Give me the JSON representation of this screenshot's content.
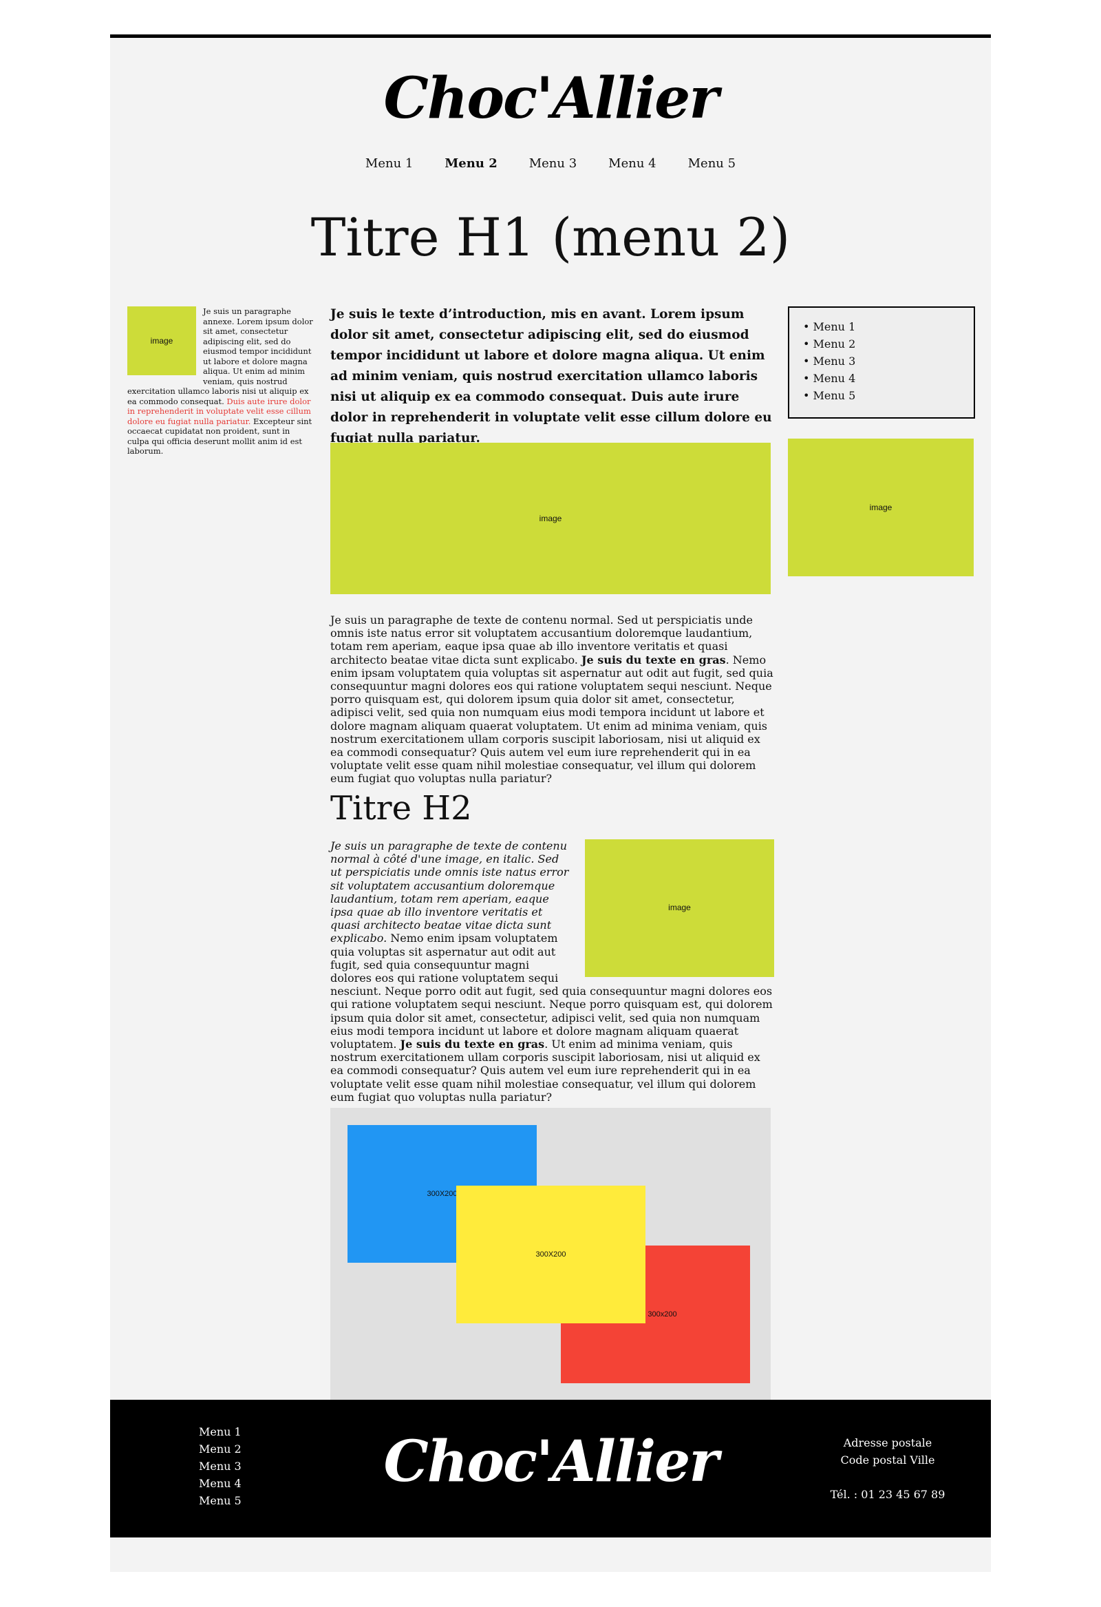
{
  "brand": {
    "logo_text": "Choc'Allier"
  },
  "nav": {
    "items": [
      "Menu 1",
      "Menu 2",
      "Menu 3",
      "Menu 4",
      "Menu 5"
    ],
    "active": "Menu 2"
  },
  "page_title": "Titre H1 (menu 2)",
  "left_column": {
    "image_label": "image",
    "text_before_red": "Je suis un paragraphe annexe. Lorem ipsum dolor sit amet, consectetur adipiscing elit, sed do eiusmod tempor incididunt ut labore et dolore magna aliqua. Ut enim ad minim veniam, quis nostrud exercitation ullamco laboris nisi ut aliquip ex ea commodo consequat. ",
    "red_text": "Duis aute irure dolor in reprehenderit in voluptate velit esse cillum dolore eu fugiat nulla pariatur.",
    "text_after_red": " Excepteur sint occaecat cupidatat non proident, sunt in culpa qui officia deserunt mollit anim id est laborum."
  },
  "intro": "Je suis le texte d’introduction, mis en avant. Lorem ipsum dolor sit amet, consectetur adipiscing elit, sed do eiusmod tempor incididunt ut labore et dolore magna aliqua. Ut enim ad minim veniam, quis nostrud exercitation ullamco laboris nisi ut aliquip ex ea commodo consequat. Duis aute irure dolor in reprehenderit in voluptate velit esse cillum dolore eu fugiat nulla pariatur.",
  "main_image_label": "image",
  "paragraph1": {
    "before_bold": "Je suis un paragraphe de texte de contenu normal. Sed ut perspiciatis unde omnis iste natus error sit voluptatem accusantium doloremque laudantium, totam rem aperiam, eaque ipsa quae ab illo inventore veritatis et quasi architecto beatae vitae dicta sunt explicabo. ",
    "bold": "Je suis du texte en gras",
    "after_bold": ". Nemo enim ipsam voluptatem quia voluptas sit aspernatur aut odit aut fugit, sed quia consequuntur magni dolores eos qui ratione voluptatem sequi nesciunt. Neque porro quisquam est, qui dolorem ipsum quia dolor sit amet, consectetur, adipisci velit, sed quia non numquam eius modi tempora incidunt ut labore et dolore magnam aliquam quaerat voluptatem. Ut enim ad minima veniam, quis nostrum exercitationem ullam corporis suscipit laboriosam, nisi ut aliquid ex ea commodi consequatur? Quis autem vel eum iure reprehenderit qui in ea voluptate velit esse quam nihil molestiae consequatur, vel illum qui dolorem eum fugiat quo voluptas nulla pariatur?"
  },
  "h2": "Titre H2",
  "paragraph2": {
    "image_label": "image",
    "italic": "Je suis un paragraphe de texte de contenu normal à côté d'une image, en italic. Sed ut perspiciatis unde omnis iste natus error sit voluptatem accusantium doloremque laudantium, totam rem aperiam, eaque ipsa quae ab illo inventore veritatis et quasi architecto beatae vitae dicta sunt explicabo.",
    "before_bold": " Nemo enim ipsam voluptatem quia voluptas sit aspernatur aut odit aut fugit, sed quia consequuntur magni dolores eos qui ratione voluptatem sequi nesciunt. Neque porro odit aut fugit, sed quia consequuntur magni dolores eos qui ratione voluptatem sequi nesciunt. Neque porro quisquam est, qui dolorem ipsum quia dolor sit amet, consectetur, adipisci velit, sed quia non numquam eius modi tempora incidunt ut labore et dolore magnam aliquam quaerat voluptatem. ",
    "bold": "Je suis du texte en gras",
    "after_bold": ". Ut enim ad minima veniam, quis nostrum exercitationem ullam corporis suscipit laboriosam, nisi ut aliquid ex ea commodi consequatur? Quis autem vel eum iure reprehenderit qui in ea voluptate velit esse quam nihil molestiae consequatur, vel illum qui dolorem eum fugiat quo voluptas nulla pariatur?"
  },
  "gallery": {
    "boxes": [
      {
        "label": "300X200",
        "color": "#2196f3"
      },
      {
        "label": "300x200",
        "color": "#f44336"
      },
      {
        "label": "300X200",
        "color": "#ffeb3b"
      }
    ]
  },
  "aside": {
    "menu": [
      "• Menu 1",
      "• Menu 2",
      "• Menu 3",
      "• Menu 4",
      "• Menu 5"
    ],
    "image_label": "image"
  },
  "footer": {
    "menu": [
      "Menu 1",
      "Menu 2",
      "Menu 3",
      "Menu 4",
      "Menu 5"
    ],
    "address_line1": "Adresse postale",
    "address_line2": "Code postal Ville",
    "phone": "Tél. : 01 23 45 67 89"
  },
  "colors": {
    "placeholder": "#cddc39",
    "page_bg": "#f3f3f3",
    "footer_bg": "#000000",
    "highlight_red": "#e53935"
  }
}
